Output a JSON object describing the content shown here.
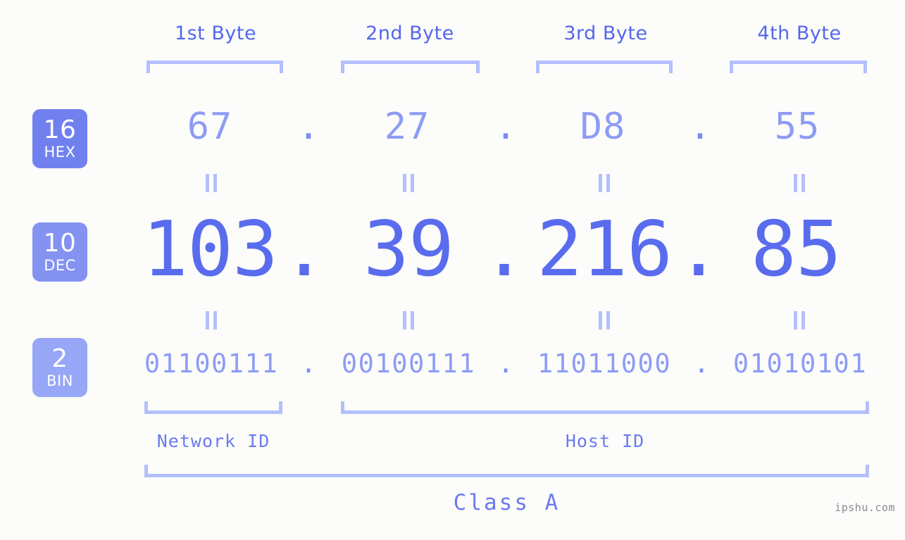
{
  "background_color": "#fcfdfa",
  "accent_color": "#5a6cee",
  "bracket_color": "#b3c0fb",
  "byte_headers": [
    {
      "label": "1st Byte"
    },
    {
      "label": "2nd Byte"
    },
    {
      "label": "3rd Byte"
    },
    {
      "label": "4th Byte"
    }
  ],
  "radix_badges": [
    {
      "number": "16",
      "abbr": "HEX",
      "color": "#7081ef"
    },
    {
      "number": "10",
      "abbr": "DEC",
      "color": "#8492f2"
    },
    {
      "number": "2",
      "abbr": "BIN",
      "color": "#97a6f7"
    }
  ],
  "rows": {
    "hex": {
      "octets": [
        "67",
        "27",
        "D8",
        "55"
      ],
      "separator": "."
    },
    "dec": {
      "octets": [
        "103",
        "39",
        "216",
        "85"
      ],
      "separator": "."
    },
    "bin": {
      "octets": [
        "01100111",
        "00100111",
        "11011000",
        "01010101"
      ],
      "separator": "."
    }
  },
  "equality_symbol": "=",
  "segments": {
    "network_id": "Network ID",
    "host_id": "Host ID",
    "class": "Class A"
  },
  "watermark": "ipshu.com"
}
